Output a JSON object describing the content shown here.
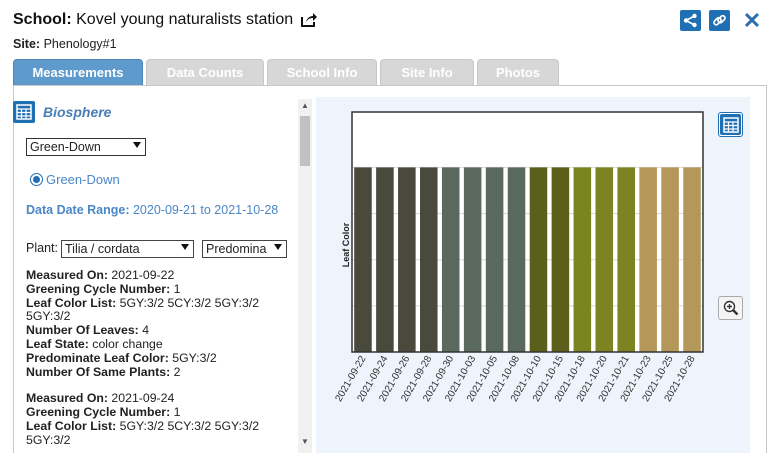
{
  "header": {
    "school_label": "School:",
    "school_name": "Kovel young naturalists station",
    "site_label": "Site:",
    "site_name": "Phenology#1"
  },
  "tabs": [
    {
      "label": "Measurements",
      "active": true
    },
    {
      "label": "Data Counts",
      "active": false
    },
    {
      "label": "School Info",
      "active": false
    },
    {
      "label": "Site Info",
      "active": false
    },
    {
      "label": "Photos",
      "active": false
    }
  ],
  "left": {
    "section_title": "Biosphere",
    "protocol_select": "Green-Down",
    "radio_label": "Green-Down",
    "range_label": "Data Date Range:",
    "range_value": "2020-09-21 to 2021-10-28",
    "plant_label": "Plant:",
    "plant_select": "Tilia / cordata",
    "color_select": "Predomina",
    "records": [
      {
        "measured_on_label": "Measured On:",
        "measured_on": "2021-09-22",
        "cycle_label": "Greening Cycle Number:",
        "cycle": "1",
        "color_list_label": "Leaf Color List:",
        "color_list": "5GY:3/2 5CY:3/2 5GY:3/2 5GY:3/2",
        "leaves_label": "Number Of Leaves:",
        "leaves": "4",
        "state_label": "Leaf State:",
        "state": "color change",
        "predominate_label": "Predominate Leaf Color:",
        "predominate": "5GY:3/2",
        "same_plants_label": "Number Of Same Plants:",
        "same_plants": "2"
      },
      {
        "measured_on_label": "Measured On:",
        "measured_on": "2021-09-24",
        "cycle_label": "Greening Cycle Number:",
        "cycle": "1",
        "color_list_label": "Leaf Color List:",
        "color_list": "5GY:3/2 5CY:3/2 5GY:3/2 5GY:3/2"
      }
    ]
  },
  "colors": {
    "accent": "#1f6fb4",
    "tab_active": "#5e9acb",
    "tab_inactive": "#d7d7d7",
    "chart_bg": "#eef4fb"
  },
  "chart_data": {
    "type": "bar",
    "ylabel": "Leaf Color",
    "categories": [
      "2021-09-22",
      "2021-09-24",
      "2021-09-26",
      "2021-09-28",
      "2021-09-30",
      "2021-10-03",
      "2021-10-05",
      "2021-10-08",
      "2021-10-10",
      "2021-10-15",
      "2021-10-18",
      "2021-10-20",
      "2021-10-21",
      "2021-10-23",
      "2021-10-25",
      "2021-10-28"
    ],
    "values": [
      1,
      1,
      1,
      1,
      1,
      1,
      1,
      1,
      1,
      1,
      1,
      1,
      1,
      1,
      1,
      1
    ],
    "colors": [
      "#494a3b",
      "#494a3b",
      "#494a3b",
      "#494a3b",
      "#59695e",
      "#59695e",
      "#59695e",
      "#59695e",
      "#5c5f1a",
      "#5c5f1a",
      "#7b8420",
      "#7b8420",
      "#7b8420",
      "#b5975a",
      "#b5975a",
      "#b5975a"
    ],
    "ylim": [
      0,
      1.3
    ],
    "grid": true
  }
}
